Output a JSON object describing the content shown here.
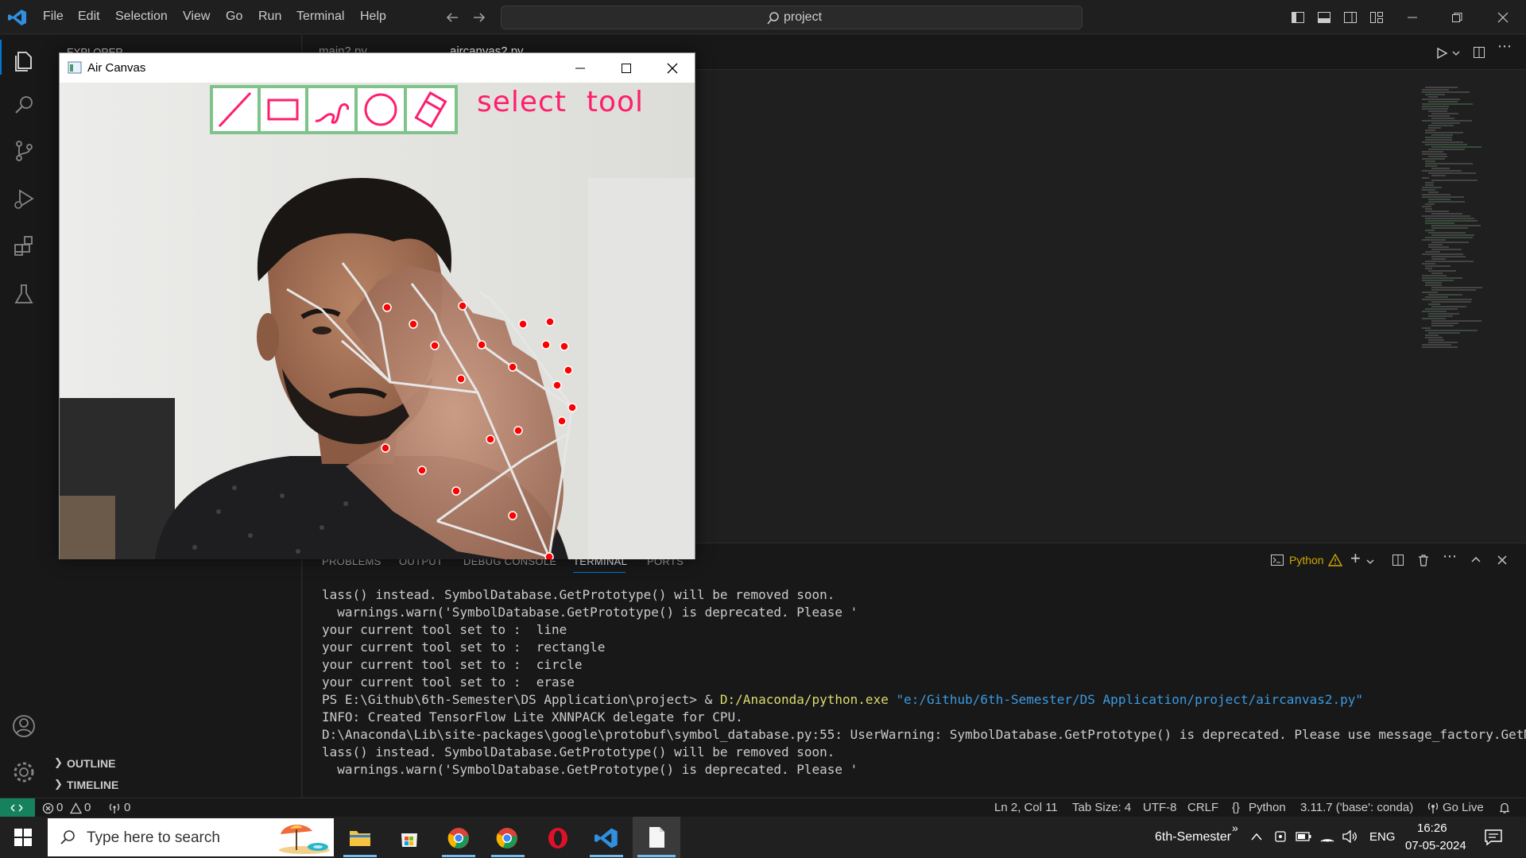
{
  "menubar": {
    "items": [
      "File",
      "Edit",
      "Selection",
      "View",
      "Go",
      "Run",
      "Terminal",
      "Help"
    ],
    "search_text": "project"
  },
  "sidebar": {
    "title": "EXPLORER",
    "outline": "OUTLINE",
    "timeline": "TIMELINE"
  },
  "editor_tabs": [
    "main2.py",
    "aircanvas2.py"
  ],
  "aircanvas": {
    "title": "Air Canvas",
    "status_text": "select  tool",
    "tools": [
      "line-tool",
      "rectangle-tool",
      "draw-tool",
      "circle-tool",
      "erase-tool"
    ]
  },
  "panel": {
    "tabs": [
      "PROBLEMS",
      "OUTPUT",
      "DEBUG CONSOLE",
      "TERMINAL",
      "PORTS"
    ],
    "active_tab": "TERMINAL",
    "terminal_profile": "Python",
    "lines": [
      {
        "text": "lass() instead. SymbolDatabase.GetPrototype() will be removed soon."
      },
      {
        "text": "  warnings.warn('SymbolDatabase.GetPrototype() is deprecated. Please '"
      },
      {
        "text": "your current tool set to :  line"
      },
      {
        "text": "your current tool set to :  rectangle"
      },
      {
        "text": "your current tool set to :  circle"
      },
      {
        "text": "your current tool set to :  erase"
      },
      {
        "prompt": "PS E:\\Github\\6th-Semester\\DS Application\\project> & ",
        "exe": "D:/Anaconda/python.exe",
        "arg": " \"e:/Github/6th-Semester/DS Application/project/aircanvas2.py\""
      },
      {
        "text": "INFO: Created TensorFlow Lite XNNPACK delegate for CPU."
      },
      {
        "text": "D:\\Anaconda\\Lib\\site-packages\\google\\protobuf\\symbol_database.py:55: UserWarning: SymbolDatabase.GetPrototype() is deprecated. Please use message_factory.GetMessageC"
      },
      {
        "text": "lass() instead. SymbolDatabase.GetPrototype() will be removed soon."
      },
      {
        "text": "  warnings.warn('SymbolDatabase.GetPrototype() is deprecated. Please '"
      }
    ]
  },
  "statusbar": {
    "errors": "0",
    "warnings": "0",
    "ports": "0",
    "position": "Ln 2, Col 11",
    "tab_size": "Tab Size: 4",
    "encoding": "UTF-8",
    "eol": "CRLF",
    "language": "Python",
    "interpreter": "3.11.7 ('base': conda)",
    "go_live": "Go Live"
  },
  "taskbar": {
    "search_placeholder": "Type here to search",
    "folder_label": "6th-Semester",
    "language": "ENG",
    "time": "16:26",
    "date": "07-05-2024"
  },
  "colors": {
    "accent_green": "#16825d",
    "tool_pink": "#ff1e6e",
    "tool_border": "#7ec48a",
    "landmark_red": "#ff0000"
  }
}
